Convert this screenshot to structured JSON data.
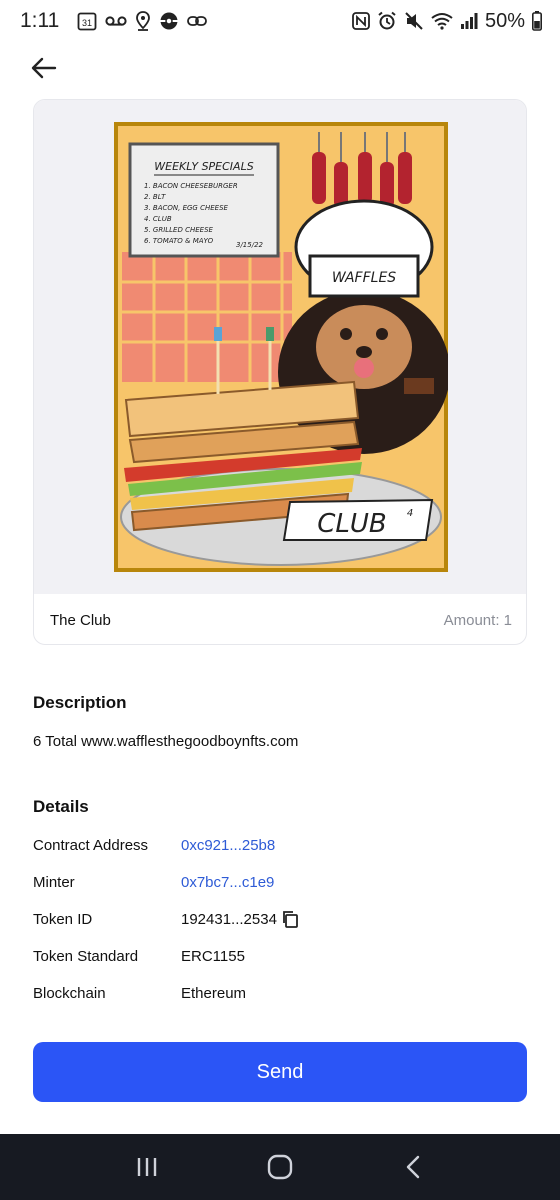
{
  "status_bar": {
    "time": "1:11",
    "calendar_day": "31",
    "battery_percent": "50%",
    "left_icons": [
      "calendar-icon",
      "voicemail-icon",
      "location-icon",
      "pokeball-icon",
      "link-icon"
    ],
    "right_icons": [
      "nfc-icon",
      "alarm-icon",
      "mute-icon",
      "wifi-icon",
      "signal-icon",
      "battery-icon"
    ]
  },
  "header": {
    "back_icon": "arrow-left-icon"
  },
  "nft": {
    "name": "The Club",
    "amount": "Amount: 1",
    "art": {
      "menu_title": "WEEKLY SPECIALS",
      "menu_items": [
        "1. BACON CHEESEBURGER",
        "2. BLT",
        "3. BACON, EGG CHEESE",
        "4. CLUB",
        "5. GRILLED CHEESE",
        "6. TOMATO & MAYO"
      ],
      "menu_date": "3/15/22",
      "hat_text": "WAFFLES",
      "sign_text": "CLUB",
      "sign_number": "4"
    }
  },
  "description": {
    "title": "Description",
    "text": "6 Total www.wafflesthegoodboynfts.com"
  },
  "details": {
    "title": "Details",
    "rows": [
      {
        "label": "Contract Address",
        "value": "0xc921...25b8"
      },
      {
        "label": "Minter",
        "value": "0x7bc7...c1e9"
      },
      {
        "label": "Token ID",
        "value": "192431...2534"
      },
      {
        "label": "Token Standard",
        "value": "ERC1155"
      },
      {
        "label": "Blockchain",
        "value": "Ethereum"
      }
    ]
  },
  "actions": {
    "send_label": "Send"
  },
  "navigation": {
    "icons": [
      "recent-apps-icon",
      "home-icon",
      "back-icon"
    ]
  },
  "colors": {
    "accent": "#2b55f6",
    "link": "#2e5bd6",
    "nav_bar": "#171a22"
  }
}
